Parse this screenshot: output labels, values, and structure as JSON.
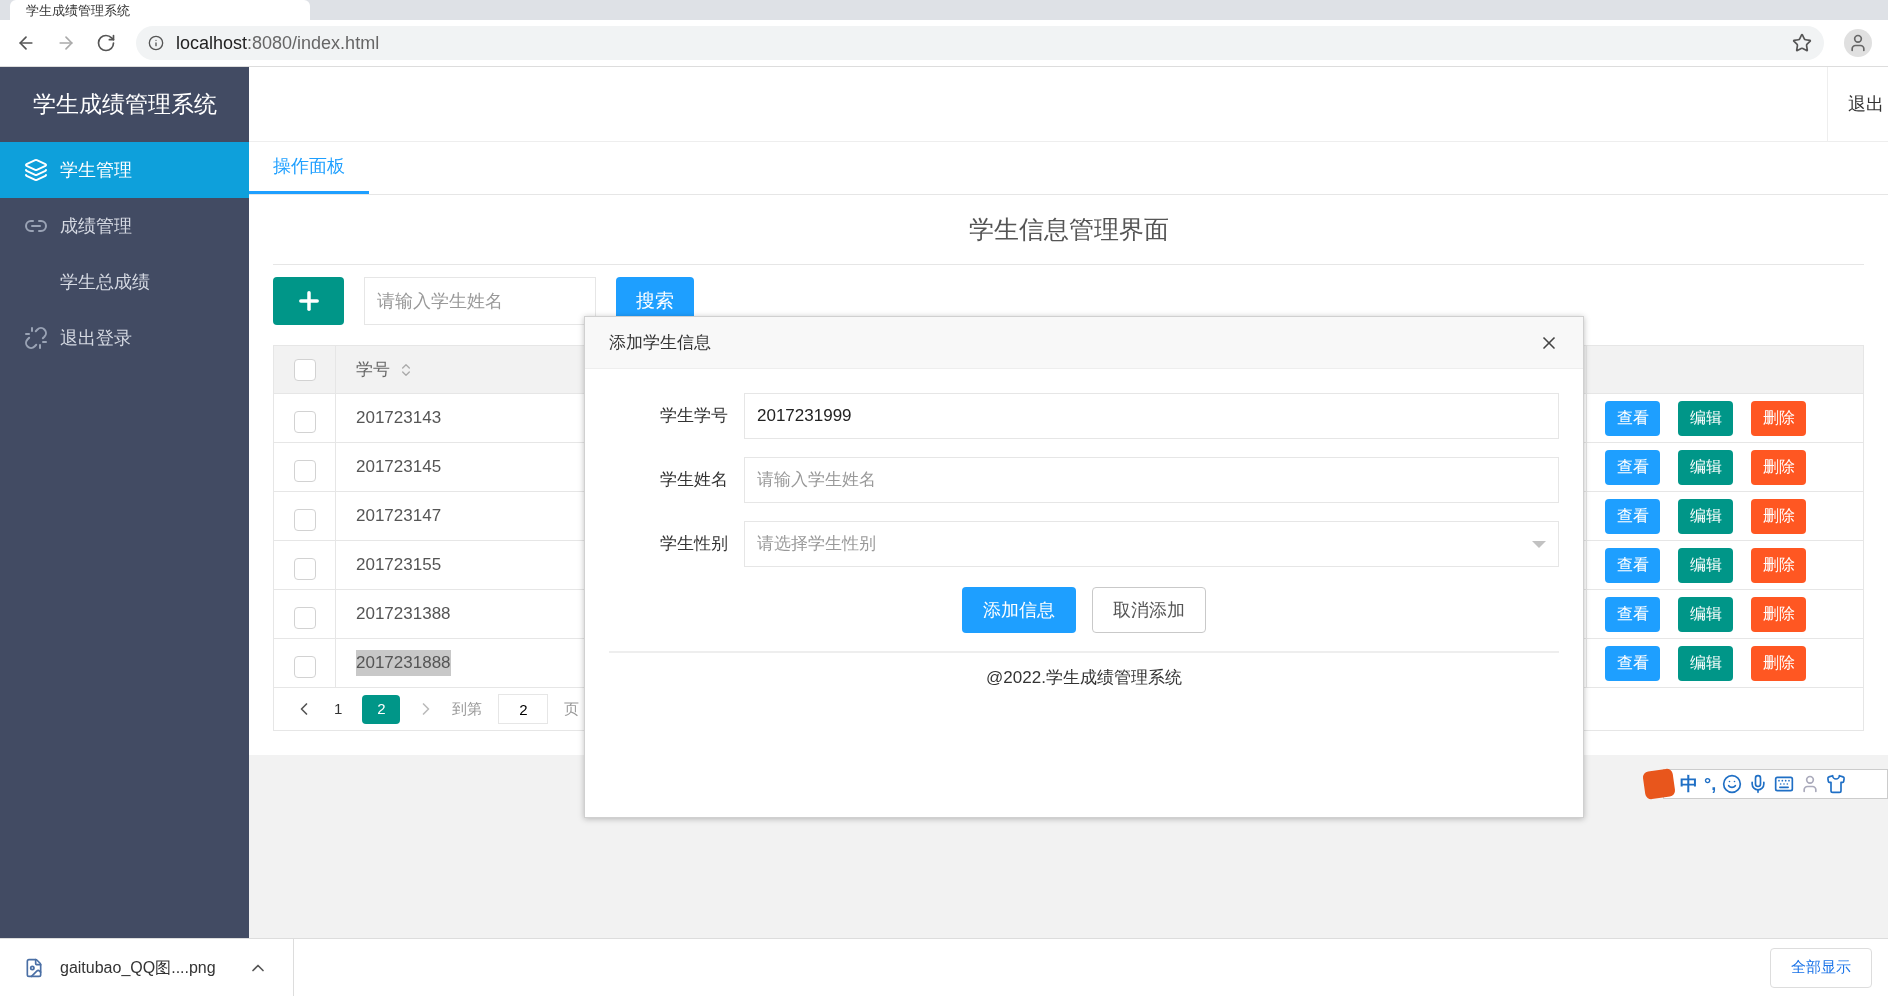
{
  "browser": {
    "tab_title": "学生成绩管理系统",
    "url_host": "localhost",
    "url_rest": ":8080/index.html"
  },
  "sidebar": {
    "title": "学生成绩管理系统",
    "items": [
      {
        "label": "学生管理",
        "kind": "layers",
        "selected": true
      },
      {
        "label": "成绩管理",
        "kind": "link",
        "selected": false
      },
      {
        "label": "学生总成绩",
        "kind": "plain",
        "selected": false
      },
      {
        "label": "退出登录",
        "kind": "chain",
        "selected": false
      }
    ]
  },
  "header": {
    "logout": "退出"
  },
  "tabs": [
    {
      "label": "操作面板",
      "selected": true
    }
  ],
  "page_title": "学生信息管理界面",
  "toolbar": {
    "search_placeholder": "请输入学生姓名",
    "search_button": "搜索"
  },
  "table": {
    "column_1": "学号",
    "select_all_checked": false,
    "rows": [
      {
        "id": "201723143",
        "checked": false,
        "highlighted": false,
        "actions": [
          "查看",
          "编辑",
          "删除"
        ]
      },
      {
        "id": "201723145",
        "checked": false,
        "highlighted": false,
        "actions": [
          "查看",
          "编辑",
          "删除"
        ]
      },
      {
        "id": "201723147",
        "checked": false,
        "highlighted": false,
        "actions": [
          "查看",
          "编辑",
          "删除"
        ]
      },
      {
        "id": "201723155",
        "checked": false,
        "highlighted": false,
        "actions": [
          "查看",
          "编辑",
          "删除"
        ]
      },
      {
        "id": "2017231388",
        "checked": false,
        "highlighted": false,
        "actions": [
          "查看",
          "编辑",
          "删除"
        ]
      },
      {
        "id": "2017231888",
        "checked": false,
        "highlighted": true,
        "actions": [
          "查看",
          "编辑",
          "删除"
        ]
      }
    ]
  },
  "pagination": {
    "pages": [
      {
        "label": "1",
        "selected": false
      },
      {
        "label": "2",
        "selected": true
      }
    ],
    "goto_label": "到第",
    "goto_value": "2",
    "page_suffix": "页"
  },
  "modal": {
    "title": "添加学生信息",
    "fields": [
      {
        "label": "学生学号",
        "kind": "text",
        "value": "2017231999"
      },
      {
        "label": "学生姓名",
        "kind": "text",
        "placeholder": "请输入学生姓名"
      },
      {
        "label": "学生性别",
        "kind": "select",
        "placeholder": "请选择学生性别"
      }
    ],
    "buttons": [
      {
        "label": "添加信息",
        "kind": "primary"
      },
      {
        "label": "取消添加",
        "kind": "default"
      }
    ],
    "footer": "@2022.学生成绩管理系统"
  },
  "ime": {
    "mode": "中",
    "punct": "°,"
  },
  "downloads": {
    "filename": "gaitubao_QQ图....png",
    "show_all": "全部显示"
  }
}
